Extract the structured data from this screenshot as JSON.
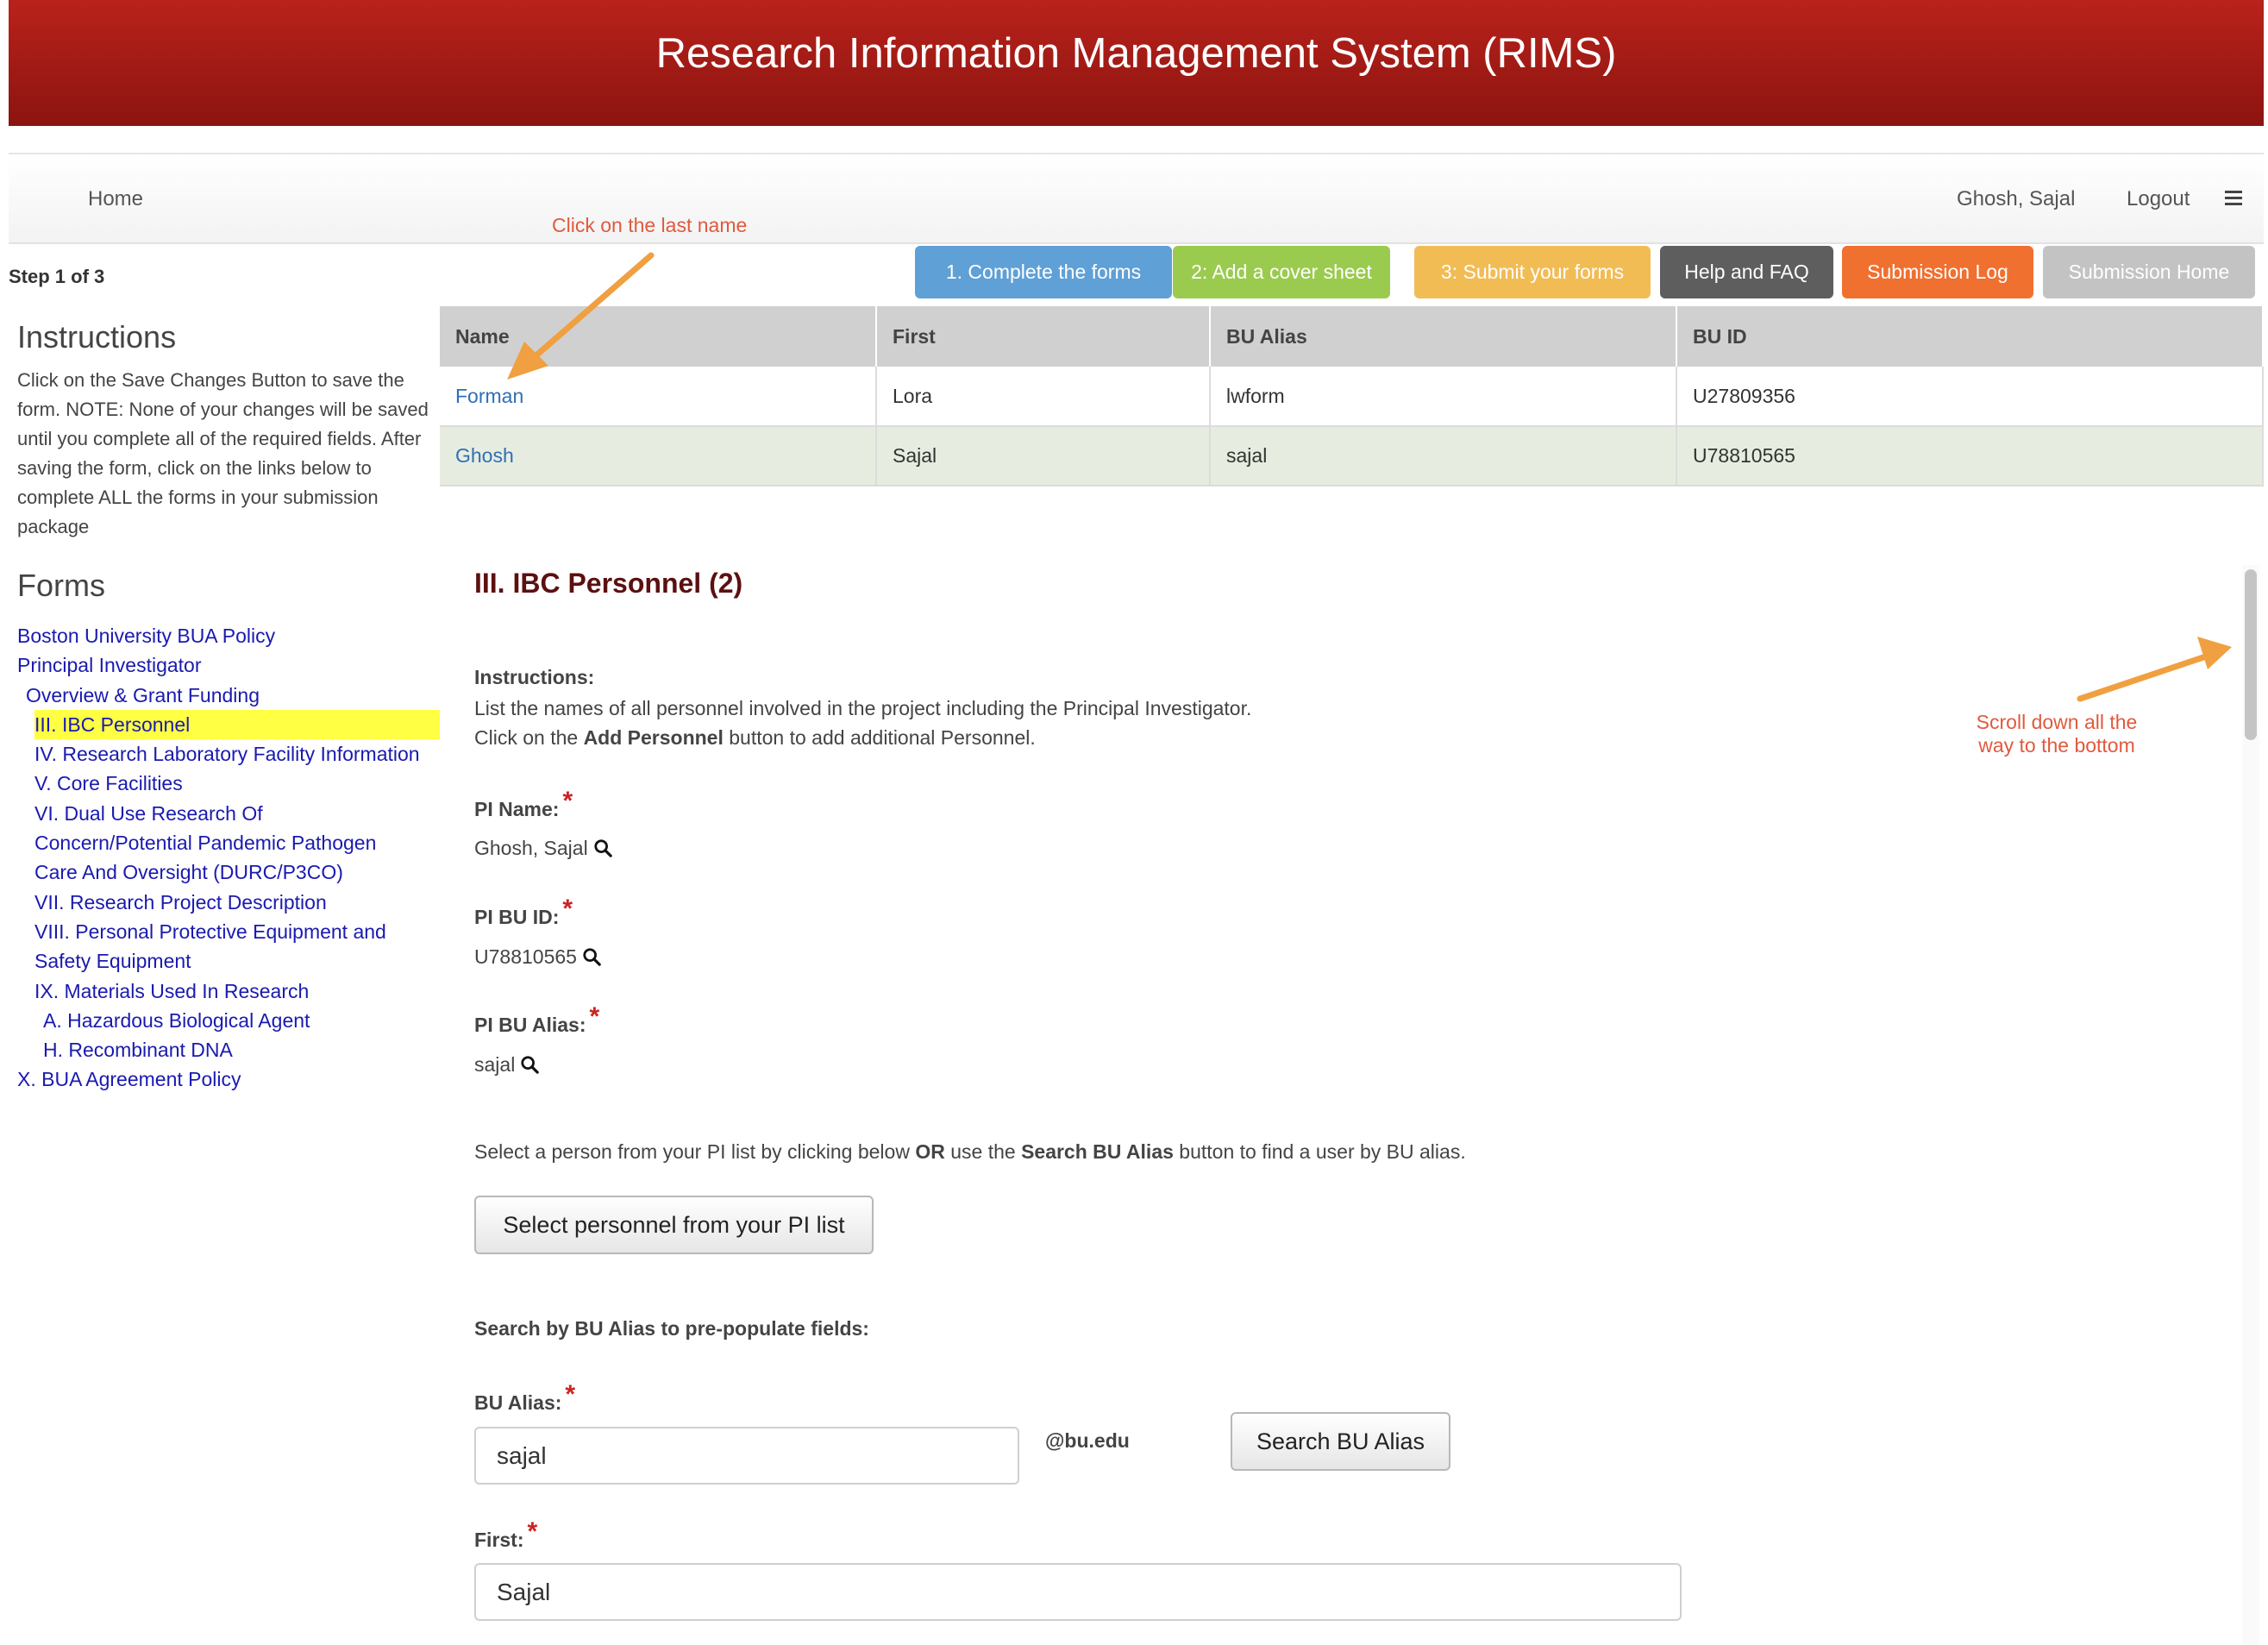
{
  "app": {
    "title": "Research Information Management System (RIMS)"
  },
  "nav": {
    "home": "Home",
    "user": "Ghosh, Sajal",
    "logout": "Logout",
    "menu_icon": "hamburger-icon"
  },
  "step_label": "Step 1 of 3",
  "steps": [
    {
      "label": "1. Complete the forms",
      "color": "#5fa0d6"
    },
    {
      "label": "2: Add a cover sheet",
      "color": "#9acb4f"
    },
    {
      "label": "3: Submit your forms",
      "color": "#f2bc55"
    },
    {
      "label": "Help and FAQ",
      "color": "#5e5e5e"
    },
    {
      "label": "Submission Log",
      "color": "#f07030"
    },
    {
      "label": "Submission Home",
      "color": "#c3c3c3"
    }
  ],
  "personnel_table": {
    "headers": [
      "Name",
      "First",
      "BU Alias",
      "BU ID"
    ],
    "rows": [
      [
        "Forman",
        "Lora",
        "lwform",
        "U27809356"
      ],
      [
        "Ghosh",
        "Sajal",
        "sajal",
        "U78810565"
      ]
    ]
  },
  "sidebar": {
    "instructions_title": "Instructions",
    "instructions_text": "Click on the Save Changes Button to save the form. NOTE: None of your changes will be saved until you complete all of the required fields. After saving the form, click on the links below to complete ALL the forms in your submission package",
    "forms_title": "Forms",
    "forms": [
      "Boston University BUA Policy",
      "Principal Investigator",
      "Overview & Grant Funding",
      "III. IBC Personnel",
      "IV. Research Laboratory Facility Information",
      "V. Core Facilities",
      "VI. Dual Use Research Of",
      "Concern/Potential Pandemic Pathogen",
      "Care And Oversight (DURC/P3CO)",
      "VII. Research Project Description",
      "VIII. Personal Protective Equipment and",
      "Safety Equipment",
      "IX. Materials Used In Research",
      "A. Hazardous Biological Agent",
      "H. Recombinant DNA",
      "X. BUA Agreement Policy"
    ]
  },
  "form": {
    "section_title": "III. IBC Personnel (2)",
    "instructions_label": "Instructions:",
    "instructions_line1": "List the names of all personnel involved in the project including the Principal Investigator.",
    "instructions_line2_pre": "Click on the ",
    "instructions_line2_bold": "Add Personnel",
    "instructions_line2_post": " button to add additional Personnel.",
    "pi_name_label": "PI Name:",
    "pi_name_value": "Ghosh, Sajal",
    "pi_buid_label": "PI BU ID:",
    "pi_buid_value": "U78810565",
    "pi_alias_label": "PI BU Alias:",
    "pi_alias_value": "sajal",
    "select_text_1": "Select a person from your PI list by clicking below ",
    "select_text_or": "OR",
    "select_text_2": " use the ",
    "select_text_bold": "Search BU Alias",
    "select_text_3": " button to find a user by BU alias.",
    "select_button": "Select personnel from your PI list",
    "search_heading": "Search by BU Alias to pre-populate fields:",
    "bu_alias_label": "BU Alias:",
    "bu_alias_value": "sajal",
    "domain_suffix": "@bu.edu",
    "search_button": "Search BU Alias",
    "first_label": "First:",
    "first_value": "Sajal"
  },
  "annotations": {
    "click_last_name": "Click on the last name",
    "scroll_line1": "Scroll down all the",
    "scroll_line2": "way to the bottom",
    "arrow_color": "#f0a040"
  }
}
